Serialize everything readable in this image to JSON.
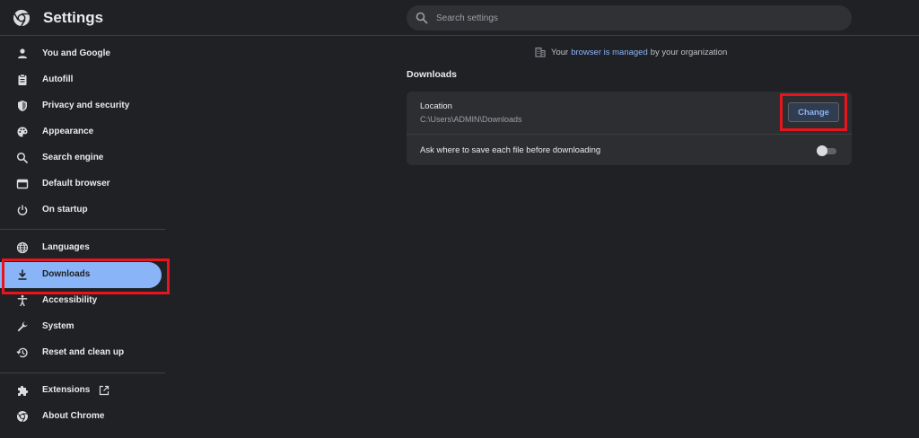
{
  "header": {
    "title": "Settings",
    "search_placeholder": "Search settings"
  },
  "sidebar": {
    "items": [
      {
        "label": "You and Google",
        "icon": "person-icon"
      },
      {
        "label": "Autofill",
        "icon": "clipboard-icon"
      },
      {
        "label": "Privacy and security",
        "icon": "shield-icon"
      },
      {
        "label": "Appearance",
        "icon": "palette-icon"
      },
      {
        "label": "Search engine",
        "icon": "search-icon"
      },
      {
        "label": "Default browser",
        "icon": "browser-window-icon"
      },
      {
        "label": "On startup",
        "icon": "power-icon"
      },
      {
        "label": "Languages",
        "icon": "globe-icon"
      },
      {
        "label": "Downloads",
        "icon": "download-icon",
        "active": true
      },
      {
        "label": "Accessibility",
        "icon": "accessibility-icon"
      },
      {
        "label": "System",
        "icon": "wrench-icon"
      },
      {
        "label": "Reset and clean up",
        "icon": "history-icon"
      },
      {
        "label": "Extensions",
        "icon": "puzzle-icon"
      },
      {
        "label": "About Chrome",
        "icon": "chrome-icon"
      }
    ]
  },
  "managed_banner": {
    "prefix": "Your",
    "link": "browser is managed",
    "suffix": "by your organization"
  },
  "downloads": {
    "section_title": "Downloads",
    "location_label": "Location",
    "location_path": "C:\\Users\\ADMIN\\Downloads",
    "change_label": "Change",
    "ask_label": "Ask where to save each file before downloading",
    "ask_enabled": false
  },
  "colors": {
    "background": "#202124",
    "accent": "#8ab4f8",
    "highlight": "#e8141e"
  }
}
